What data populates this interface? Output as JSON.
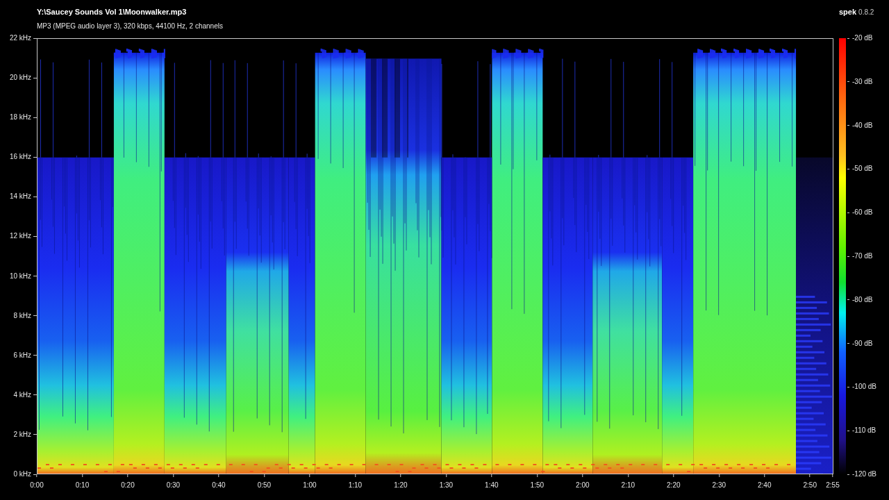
{
  "file": {
    "title": "Y:\\Saucey Sounds Vol 1\\Moonwalker.mp3",
    "info": "MP3 (MPEG audio layer 3), 320 kbps, 44100 Hz, 2 channels"
  },
  "app": {
    "name": "spek",
    "version": "0.8.2"
  },
  "frequency_axis": {
    "ticks": [
      "22 kHz",
      "20 kHz",
      "18 kHz",
      "16 kHz",
      "14 kHz",
      "12 kHz",
      "10 kHz",
      "8 kHz",
      "6 kHz",
      "4 kHz",
      "2 kHz",
      "0 kHz"
    ]
  },
  "time_axis": {
    "ticks": [
      "0:00",
      "0:10",
      "0:20",
      "0:30",
      "0:40",
      "0:50",
      "1:00",
      "1:10",
      "1:20",
      "1:30",
      "1:40",
      "1:50",
      "2:00",
      "2:10",
      "2:20",
      "2:30",
      "2:40",
      "2:50",
      "2:55"
    ]
  },
  "legend": {
    "ticks": [
      "-20 dB",
      "-30 dB",
      "-40 dB",
      "-50 dB",
      "-60 dB",
      "-70 dB",
      "-80 dB",
      "-90 dB",
      "-100 dB",
      "-110 dB",
      "-120 dB"
    ]
  }
}
